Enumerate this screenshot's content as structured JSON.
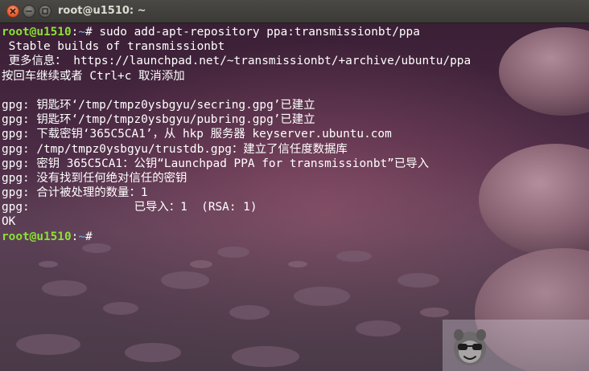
{
  "window": {
    "title": "root@u1510: ~"
  },
  "prompt": {
    "user_host": "root@u1510",
    "separator": ":",
    "path": "~",
    "symbol": "#"
  },
  "terminal": {
    "command": " sudo add-apt-repository ppa:transmissionbt/ppa",
    "output_lines": [
      " Stable builds of transmissionbt",
      " 更多信息： https://launchpad.net/~transmissionbt/+archive/ubuntu/ppa",
      "按回车继续或者 Ctrl+c 取消添加",
      "",
      "gpg: 钥匙环‘/tmp/tmpz0ysbgyu/secring.gpg’已建立",
      "gpg: 钥匙环‘/tmp/tmpz0ysbgyu/pubring.gpg’已建立",
      "gpg: 下载密钥‘365C5CA1’，从 hkp 服务器 keyserver.ubuntu.com",
      "gpg: /tmp/tmpz0ysbgyu/trustdb.gpg：建立了信任度数据库",
      "gpg: 密钥 365C5CA1：公钥“Launchpad PPA for transmissionbt”已导入",
      "gpg: 没有找到任何绝对信任的密钥",
      "gpg: 合计被处理的数量：1",
      "gpg:               已导入：1  (RSA: 1)",
      "OK"
    ]
  },
  "colors": {
    "prompt_user": "#8ae234",
    "prompt_path": "#729fcf",
    "text": "#ffffff",
    "close_button": "#e2562a"
  },
  "icons": {
    "close": "close-icon",
    "minimize": "minimize-icon",
    "maximize": "maximize-icon",
    "watermark": "mascot-icon"
  }
}
